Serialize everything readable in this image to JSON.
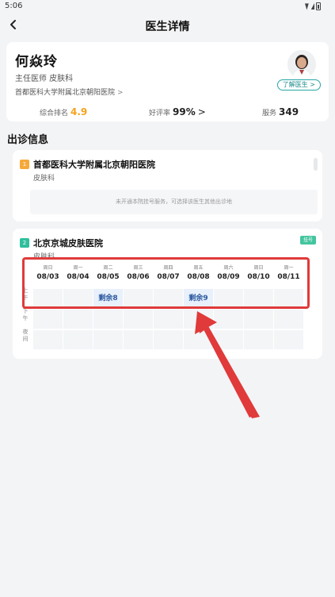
{
  "status_bar": {
    "time": "5:06"
  },
  "nav": {
    "title": "医生详情"
  },
  "doctor": {
    "name": "何焱玲",
    "title_dept": "主任医师  皮肤科",
    "hospital": "首都医科大学附属北京朝阳医院",
    "learn_button": "了解医生 >",
    "stats": {
      "rank_label": "综合排名",
      "rank_value": "4.9",
      "praise_label": "好评率",
      "praise_value": "99%",
      "service_label": "服务",
      "service_value": "349"
    }
  },
  "section_title": "出诊信息",
  "hospitals": [
    {
      "index": "1",
      "name": "首都医科大学附属北京朝阳医院",
      "dept": "皮肤科",
      "notice": "未开通本院挂号服务，可选择该医生其他出诊地"
    },
    {
      "index": "2",
      "name": "北京京城皮肤医院",
      "dept": "皮肤科",
      "tag": "挂号"
    }
  ],
  "schedule": {
    "days": [
      {
        "week": "周日",
        "date": "08/03"
      },
      {
        "week": "周一",
        "date": "08/04"
      },
      {
        "week": "周二",
        "date": "08/05"
      },
      {
        "week": "周三",
        "date": "08/06"
      },
      {
        "week": "周四",
        "date": "08/07"
      },
      {
        "week": "周五",
        "date": "08/08"
      },
      {
        "week": "周六",
        "date": "08/09"
      },
      {
        "week": "周日",
        "date": "08/10"
      },
      {
        "week": "周一",
        "date": "08/11"
      }
    ],
    "rows": [
      "上午",
      "下午",
      "夜间"
    ],
    "available": [
      {
        "row": 0,
        "day": 2,
        "label": "剩余8"
      },
      {
        "row": 0,
        "day": 5,
        "label": "剩余9"
      }
    ]
  },
  "colors": {
    "accent": "#f5a21b",
    "teal": "#27a6a6",
    "annotation": "#e03a3a"
  }
}
